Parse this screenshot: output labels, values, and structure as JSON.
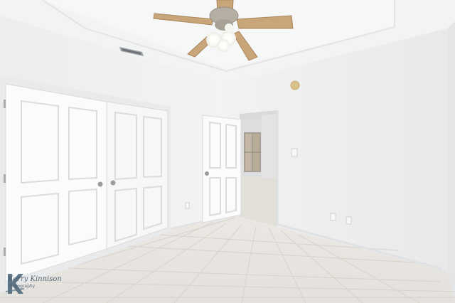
{
  "photo": {
    "subject": "empty-bedroom",
    "features": [
      "ceiling-fan",
      "double-closet-doors",
      "open-door-to-hallway",
      "tile-floor",
      "hvac-vent",
      "smoke-detector"
    ]
  },
  "watermark": {
    "line1": "Kerry Kinnison",
    "line2": "Photography"
  },
  "colors": {
    "wall": "#eef0f0",
    "ceiling": "#f4f5f5",
    "floor": "#e9e6e2",
    "door": "#fafafa",
    "fan_blade": "#c9a57a"
  }
}
